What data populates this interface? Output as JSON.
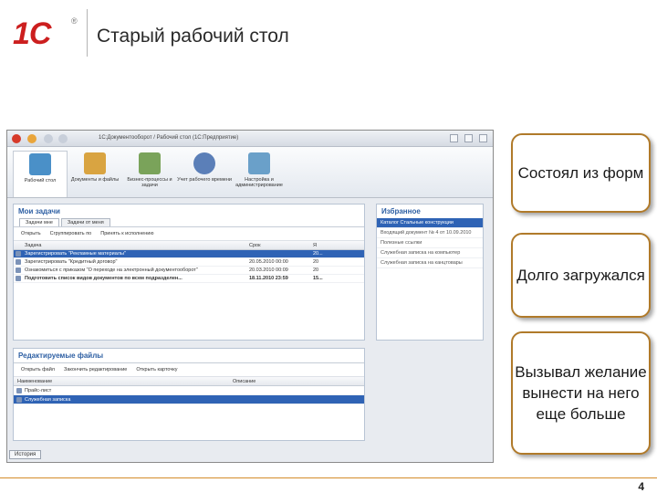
{
  "header": {
    "logo_text": "1С",
    "logo_mark": "®",
    "title": "Старый рабочий стол"
  },
  "app": {
    "window_title": "1С:Документооборот / Рабочий стол (1С:Предприятие)",
    "sections": [
      {
        "label": "Рабочий стол",
        "icon": "desktop-icon",
        "color": "#4a90c8"
      },
      {
        "label": "Документы и файлы",
        "icon": "documents-icon",
        "color": "#d9a441"
      },
      {
        "label": "Бизнес-процессы и задачи",
        "icon": "business-process-icon",
        "color": "#7aa35a"
      },
      {
        "label": "Учет рабочего времени",
        "icon": "clock-icon",
        "color": "#5b7fb8"
      },
      {
        "label": "Настройка и администрирование",
        "icon": "admin-icon",
        "color": "#6aa0c9"
      }
    ],
    "tasks_panel": {
      "title": "Мои задачи",
      "tabs": [
        "Задачи мне",
        "Задачи от меня"
      ],
      "toolbar": [
        "Открыть",
        "Сгруппировать по",
        "Принять к исполнению"
      ],
      "columns": [
        "Задача",
        "Срок",
        "Я"
      ],
      "rows": [
        {
          "task": "Зарегистрировать \"Рекламные материалы\"",
          "date": "",
          "num": "20..."
        },
        {
          "task": "Зарегистрировать \"Кредитный договор\"",
          "date": "20.05.2010 00:00",
          "num": "20"
        },
        {
          "task": "Ознакомиться с приказом \"О переходе на электронный документооборот\"",
          "date": "20.03.2010 00:09",
          "num": "20"
        },
        {
          "task": "Подготовить список видов документов по всем подразделен...",
          "date": "18.11.2010 23:59",
          "num": "15..."
        }
      ]
    },
    "favorites_panel": {
      "title": "Избранное",
      "items": [
        "Каталог Стальные конструкции",
        "Входящий документ № 4 от 10.09.2010",
        "Полезные ссылки",
        "Служебная записка на компьютер",
        "Служебная записка на канцтовары"
      ]
    },
    "edited_files_panel": {
      "title": "Редактируемые файлы",
      "toolbar": [
        "Открыть файл",
        "Закончить редактирование",
        "Открыть карточку"
      ],
      "columns": [
        "Наименование",
        "Описание"
      ],
      "rows": [
        "Прайс-лист",
        "Служебная записка"
      ]
    },
    "history_button": "История"
  },
  "callouts": [
    {
      "text": "Состоял из форм"
    },
    {
      "text": "Долго загружался"
    },
    {
      "text": "Вызывал желание вынести на него еще больше"
    }
  ],
  "page_number": "4",
  "colors": {
    "accent_orange": "#d48c2a",
    "logo_red": "#cc1f1f",
    "selection_blue": "#2f63b5",
    "panel_title_blue": "#2d5fa3"
  }
}
